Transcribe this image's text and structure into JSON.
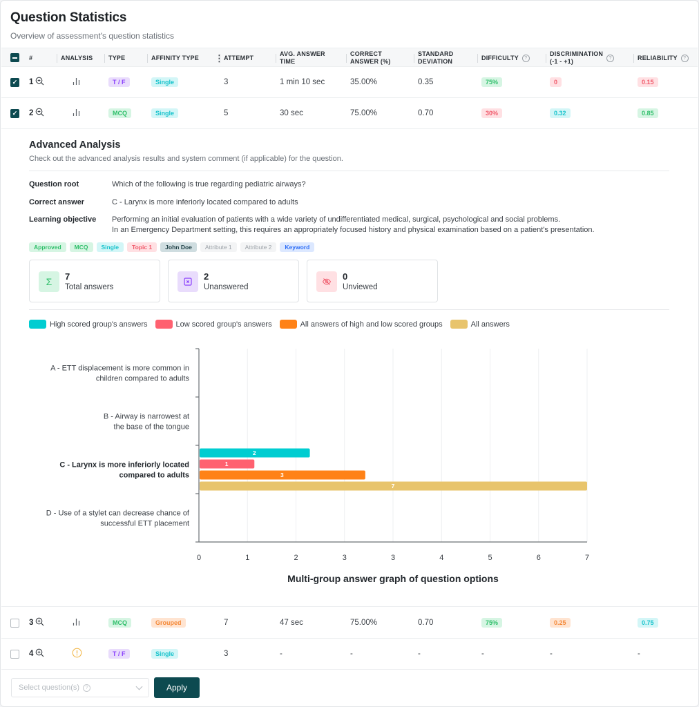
{
  "header": {
    "title": "Question Statistics",
    "subtitle": "Overview of assessment's question statistics"
  },
  "columns": [
    {
      "label": "#"
    },
    {
      "label": "ANALYSIS"
    },
    {
      "label": "TYPE"
    },
    {
      "label": "AFFINITY TYPE"
    },
    {
      "label": "ATTEMPT"
    },
    {
      "label": "AVG. ANSWER TIME"
    },
    {
      "label": "CORRECT ANSWER (%)"
    },
    {
      "label": "STANDARD DEVIATION"
    },
    {
      "label": "DIFFICULTY",
      "help": true
    },
    {
      "label": "DISCRIMINATION (-1 - +1)",
      "help": true
    },
    {
      "label": "RELIABILITY",
      "help": true
    }
  ],
  "col_labels": {
    "num": "#",
    "analysis": "ANALYSIS",
    "type": "TYPE",
    "affinity": "AFFINITY TYPE",
    "attempt": "ATTEMPT",
    "avg_time_1": "AVG. ANSWER",
    "avg_time_2": "TIME",
    "correct_1": "CORRECT",
    "correct_2": "ANSWER (%)",
    "std_1": "STANDARD",
    "std_2": "DEVIATION",
    "difficulty": "DIFFICULTY",
    "discrimination_1": "DISCRIMINATION",
    "discrimination_2": "(-1 - +1)",
    "reliability": "RELIABILITY",
    "help_glyph": "?"
  },
  "rows": [
    {
      "num": "1",
      "checked": true,
      "analysis_icon": "bar-chart-icon",
      "type": "T / F",
      "affinity": "Single",
      "attempt": "3",
      "avg_time": "1 min 10 sec",
      "correct": "35.00%",
      "std": "0.35",
      "difficulty": "75%",
      "discrimination": "0",
      "reliability": "0.15"
    },
    {
      "num": "2",
      "checked": true,
      "analysis_icon": "bar-chart-icon",
      "type": "MCQ",
      "affinity": "Single",
      "attempt": "5",
      "avg_time": "30 sec",
      "correct": "75.00%",
      "std": "0.70",
      "difficulty": "30%",
      "discrimination": "0.32",
      "reliability": "0.85"
    },
    {
      "num": "3",
      "checked": false,
      "analysis_icon": "bar-chart-icon",
      "type": "MCQ",
      "affinity": "Grouped",
      "attempt": "7",
      "avg_time": "47 sec",
      "correct": "75.00%",
      "std": "0.70",
      "difficulty": "75%",
      "discrimination": "0.25",
      "reliability": "0.75"
    },
    {
      "num": "4",
      "checked": false,
      "analysis_icon": "warning-circle-icon",
      "type": "T / F",
      "affinity": "Single",
      "attempt": "3",
      "avg_time": "-",
      "correct": "-",
      "std": "-",
      "difficulty": "-",
      "discrimination": "-",
      "reliability": "-"
    }
  ],
  "advanced": {
    "title": "Advanced Analysis",
    "subtitle": "Check out the advanced analysis results and system comment (if applicable) for the question.",
    "question_root_label": "Question root",
    "question_root": "Which of the following is true regarding pediatric airways?",
    "correct_answer_label": "Correct answer",
    "correct_answer": "C - Larynx is more inferiorly located compared to adults",
    "learning_objective_label": "Learning objective",
    "learning_objective_1": "Performing an initial evaluation of patients with a wide variety of undifferentiated medical, surgical, psychological and social problems.",
    "learning_objective_2": "In an Emergency Department setting, this requires an appropriately focused history and physical examination based on a patient's presentation.",
    "tags": [
      "Approved",
      "MCQ",
      "Single",
      "Topic 1",
      "John Doe",
      "Attribute 1",
      "Attribute 2",
      "Keyword"
    ],
    "stats": [
      {
        "value": "7",
        "label": "Total answers",
        "icon": "sigma-icon"
      },
      {
        "value": "2",
        "label": "Unanswered",
        "icon": "x-square-icon"
      },
      {
        "value": "0",
        "label": "Unviewed",
        "icon": "eye-off-icon"
      }
    ]
  },
  "chart_data": {
    "type": "bar",
    "orientation": "horizontal",
    "title": "Multi-group answer graph of question options",
    "categories": [
      "A - ETT displacement is more common in children compared to adults",
      "B - Airway is narrowest at the base of the tongue",
      "C - Larynx is more inferiorly located compared to adults",
      "D - Use of a stylet can decrease chance of successful ETT placement"
    ],
    "category_lines": [
      [
        "A - ETT displacement is more common in",
        "children compared to adults"
      ],
      [
        "B - Airway is narrowest at",
        "the base of the tongue"
      ],
      [
        "C - Larynx is more inferiorly located",
        "compared to adults"
      ],
      [
        "D - Use of a stylet can decrease chance of",
        "successful ETT placement"
      ]
    ],
    "highlighted_category": 2,
    "series": [
      {
        "name": "High scored group's answers",
        "color": "#00cdd1",
        "values": [
          0,
          0,
          2,
          0
        ]
      },
      {
        "name": "Low scored group's answers",
        "color": "#ff6170",
        "values": [
          0,
          0,
          1,
          0
        ]
      },
      {
        "name": "All answers of high and low scored groups",
        "color": "#ff8217",
        "values": [
          0,
          0,
          3,
          0
        ]
      },
      {
        "name": "All answers",
        "color": "#e8c46c",
        "values": [
          0,
          0,
          7,
          0
        ]
      }
    ],
    "x_ticks": [
      "0",
      "1",
      "2",
      "3",
      "3",
      "4",
      "5",
      "6",
      "7"
    ],
    "xlim": [
      0,
      7
    ],
    "legend": "top-left",
    "grid": true
  },
  "footer": {
    "select_placeholder": "Select question(s)",
    "apply_label": "Apply"
  }
}
